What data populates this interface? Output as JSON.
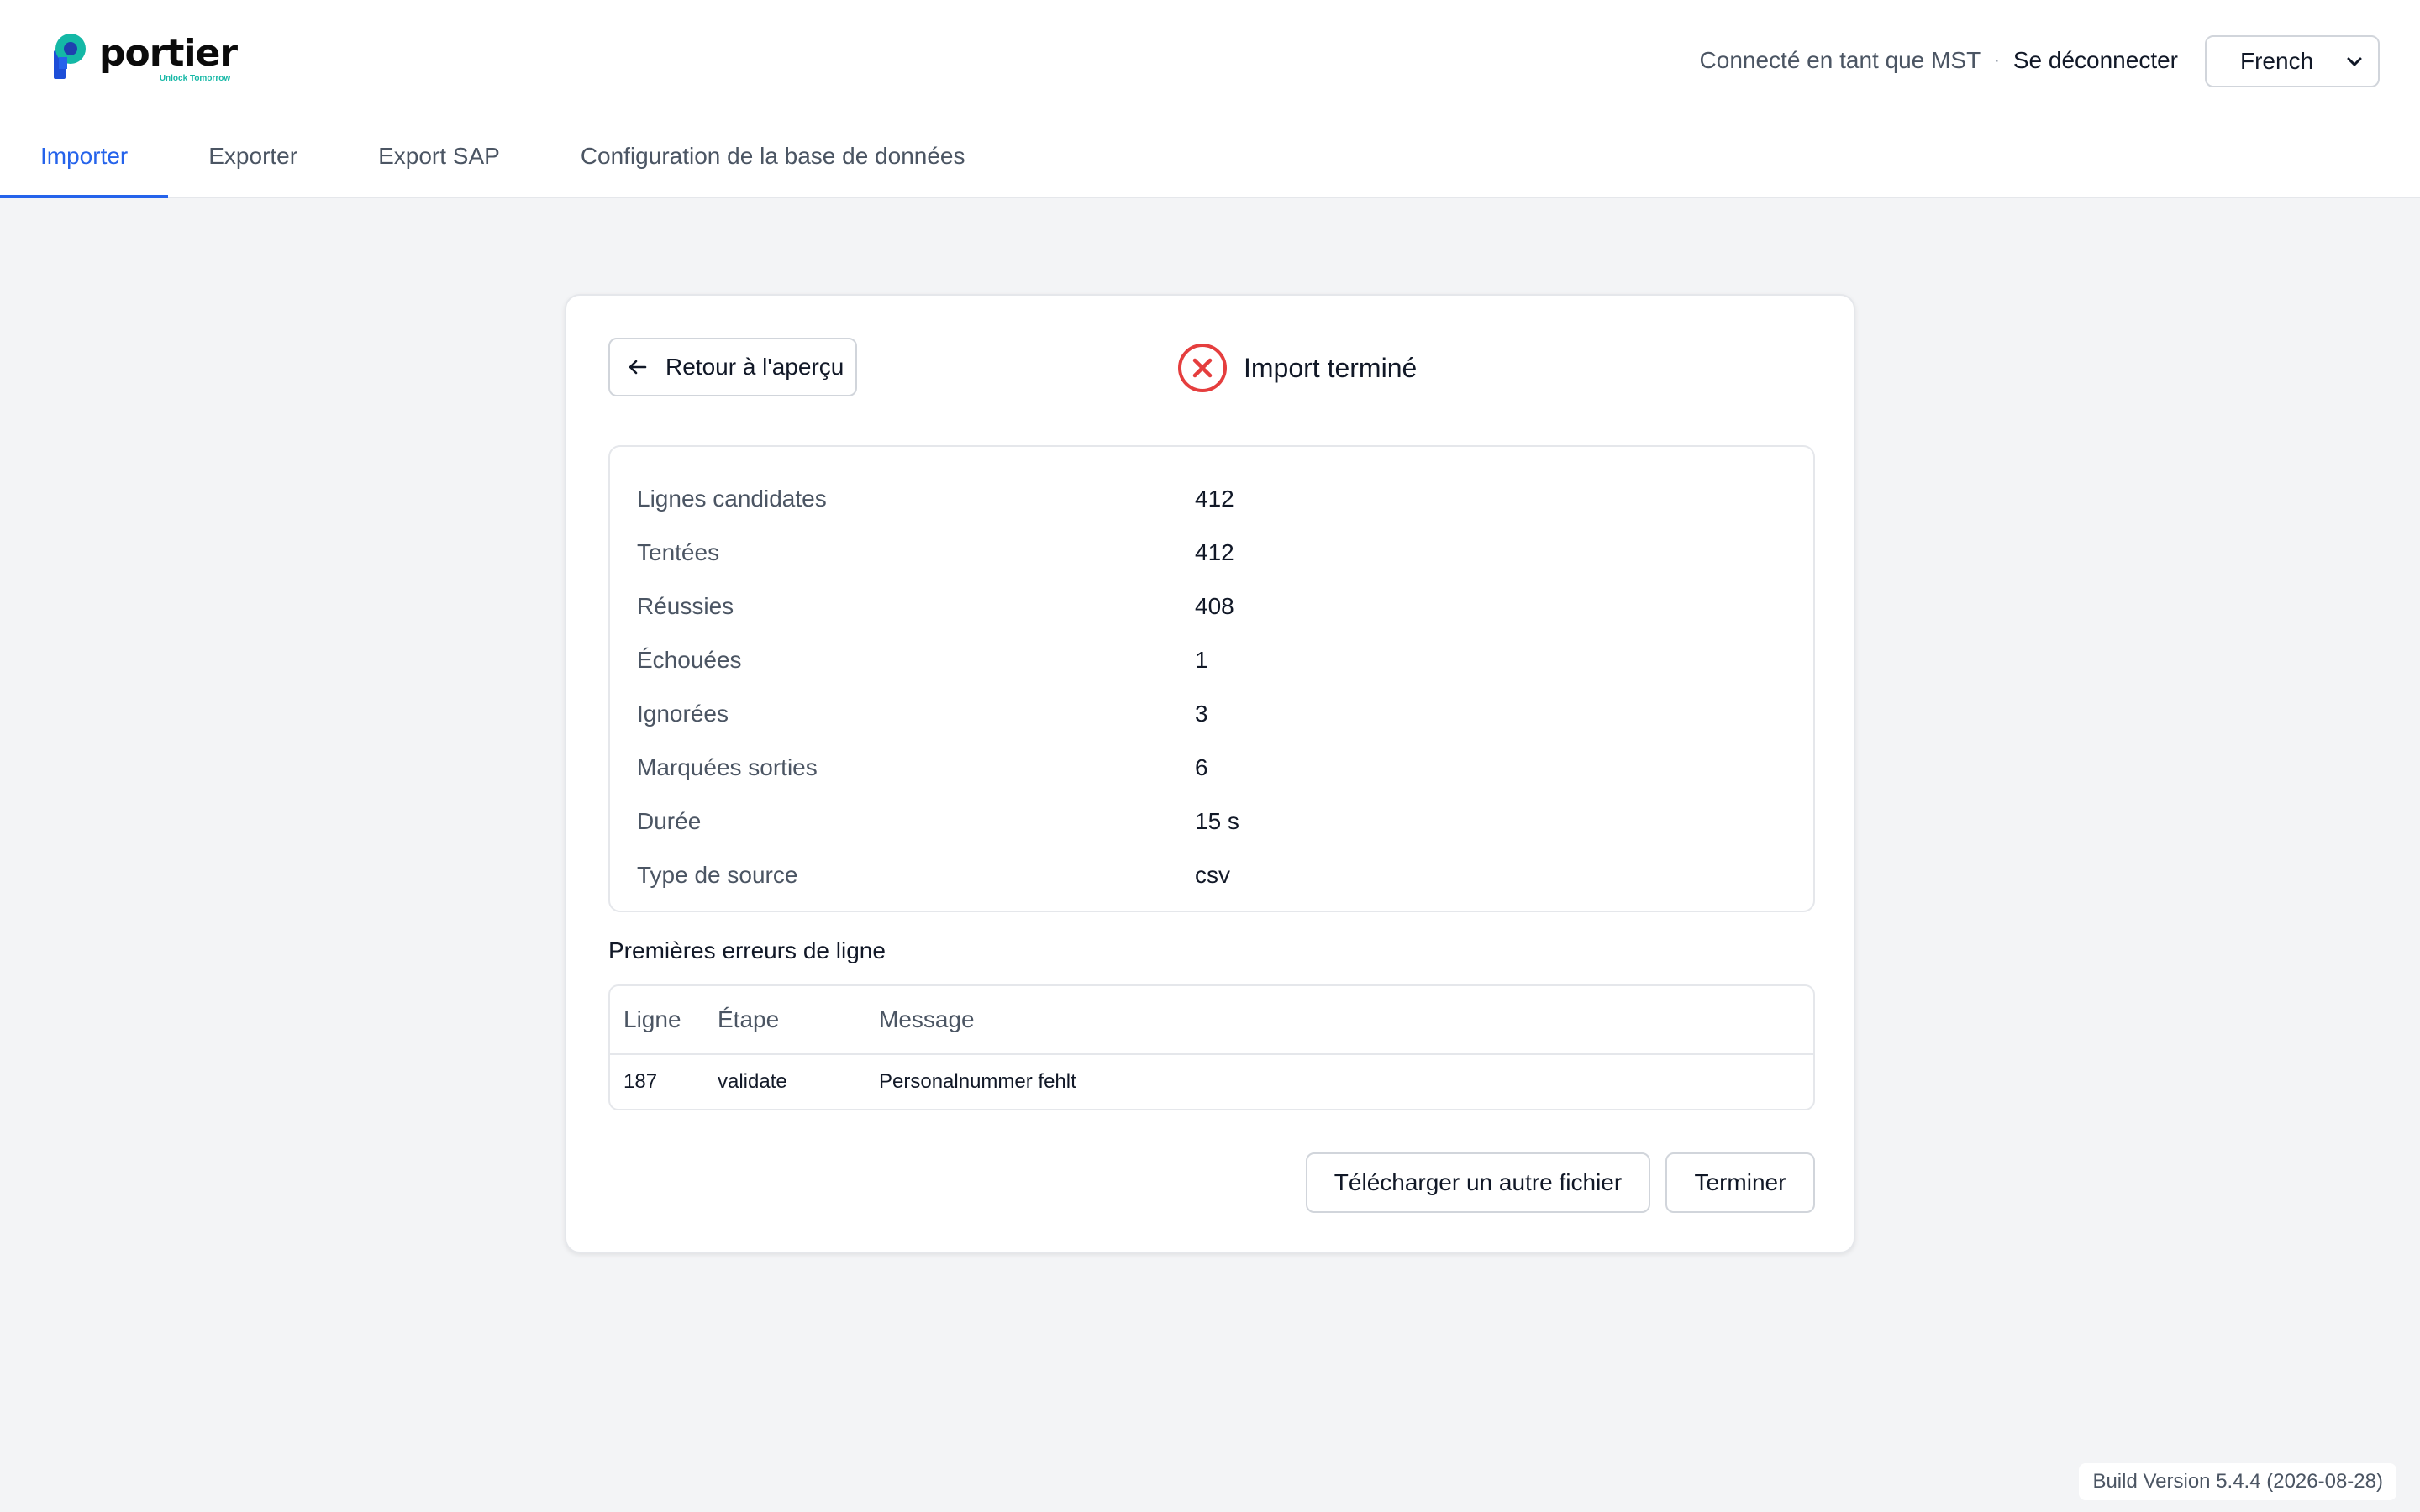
{
  "app": {
    "logo_text": "portier",
    "logo_tagline": "Unlock Tomorrow",
    "accent_color": "#2563eb",
    "brand_teal": "#16b8a6"
  },
  "header": {
    "user_label": "Connecté en tant que MST",
    "logout_label": "Se déconnecter",
    "language": {
      "selected": "French"
    }
  },
  "tabs": [
    {
      "label": "Importer",
      "active": true
    },
    {
      "label": "Exporter",
      "active": false
    },
    {
      "label": "Export SAP",
      "active": false
    },
    {
      "label": "Configuration de la base de données",
      "active": false
    }
  ],
  "card": {
    "back_label": "Retour à l'aperçu",
    "status_label": "Import terminé",
    "status_icon": "x-circle-icon",
    "status_color": "#e53e3e",
    "stats": [
      {
        "label": "Lignes candidates",
        "value": "412"
      },
      {
        "label": "Tentées",
        "value": "412"
      },
      {
        "label": "Réussies",
        "value": "408"
      },
      {
        "label": "Échouées",
        "value": "1"
      },
      {
        "label": "Ignorées",
        "value": "3"
      },
      {
        "label": "Marquées sorties",
        "value": "6"
      },
      {
        "label": "Durée",
        "value": "15 s"
      },
      {
        "label": "Type de source",
        "value": "csv"
      }
    ],
    "errors_title": "Premières erreurs de ligne",
    "errors_columns": [
      "Ligne",
      "Étape",
      "Message"
    ],
    "errors_rows": [
      {
        "line": "187",
        "step": "validate",
        "message": "Personalnummer fehlt"
      }
    ],
    "upload_another_label": "Télécharger un autre fichier",
    "finish_label": "Terminer"
  },
  "footer": {
    "build_version": "Build Version 5.4.4 (2026-08-28)"
  }
}
